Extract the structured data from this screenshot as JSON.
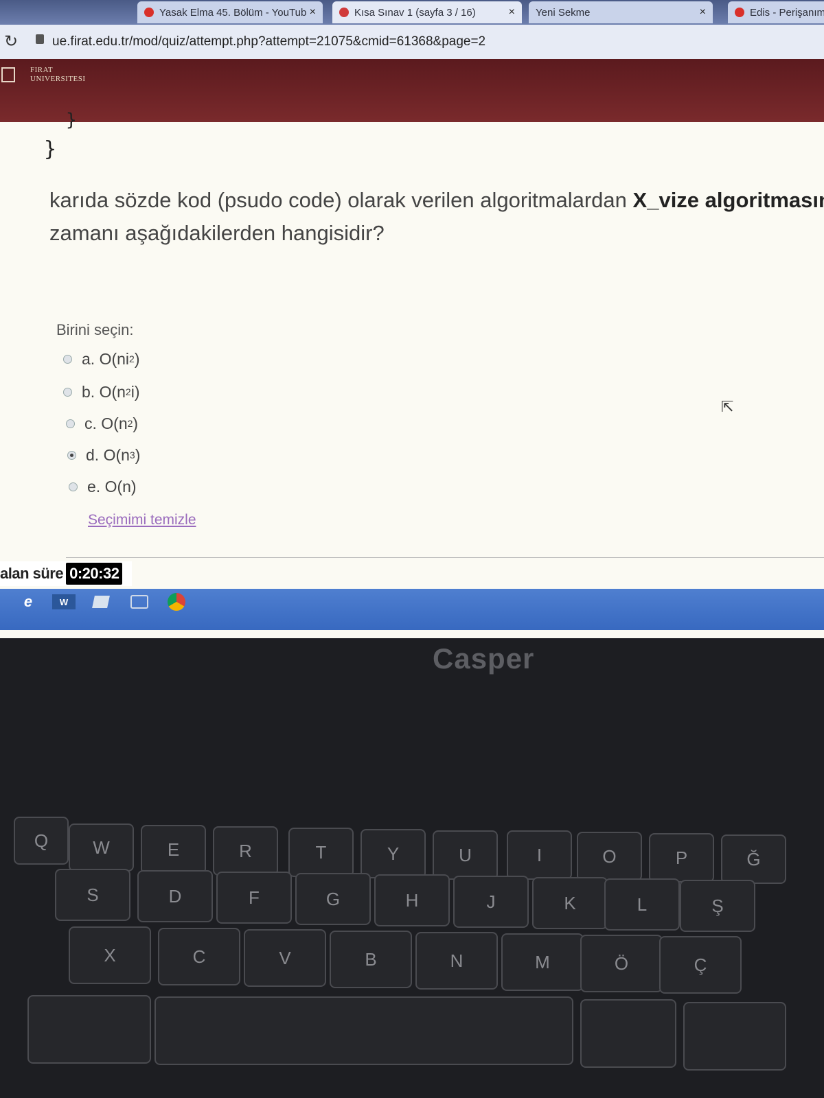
{
  "browser": {
    "tabs": [
      {
        "label": "Yasak Elma 45. Bölüm - YouTub"
      },
      {
        "label": "Kısa Sınav 1 (sayfa 3 / 16)"
      },
      {
        "label": "Yeni Sekme"
      },
      {
        "label": "Edis - Perişanım"
      }
    ],
    "url": "ue.firat.edu.tr/mod/quiz/attempt.php?attempt=21075&cmid=61368&page=2",
    "close_glyph": "×"
  },
  "site": {
    "logo_line1": "FIRAT",
    "logo_line2": "UNIVERSITESI"
  },
  "question": {
    "code_fragment_1": "}",
    "code_fragment_2": "}",
    "text_part1": "karıda sözde kod (psudo code) olarak verilen algoritmalardan ",
    "text_bold": "X_vize algoritmasın",
    "text_line2": "zamanı aşağıdakilerden hangisidir?"
  },
  "answers": {
    "prompt": "Birini seçin:",
    "options": [
      {
        "letter": "a.",
        "base": "O(ni",
        "sup": "2",
        "tail": ")",
        "selected": false
      },
      {
        "letter": "b.",
        "base": "O(n",
        "sup": "2",
        "tail": "i)",
        "selected": false
      },
      {
        "letter": "c.",
        "base": "O(n",
        "sup": "2",
        "tail": ")",
        "selected": false
      },
      {
        "letter": "d.",
        "base": "O(n",
        "sup": "3",
        "tail": ")",
        "selected": true
      },
      {
        "letter": "e.",
        "base": "O(n)",
        "sup": "",
        "tail": "",
        "selected": false
      }
    ],
    "clear_label": "Seçimimi temizle"
  },
  "timer": {
    "label": "alan süre",
    "value": "0:20:32"
  },
  "taskbar": {
    "word_label": "W"
  },
  "laptop": {
    "brand": "Casper"
  },
  "colors": {
    "header": "#6b2224",
    "link": "#9a6bbd",
    "taskbar": "#3f72c8"
  }
}
